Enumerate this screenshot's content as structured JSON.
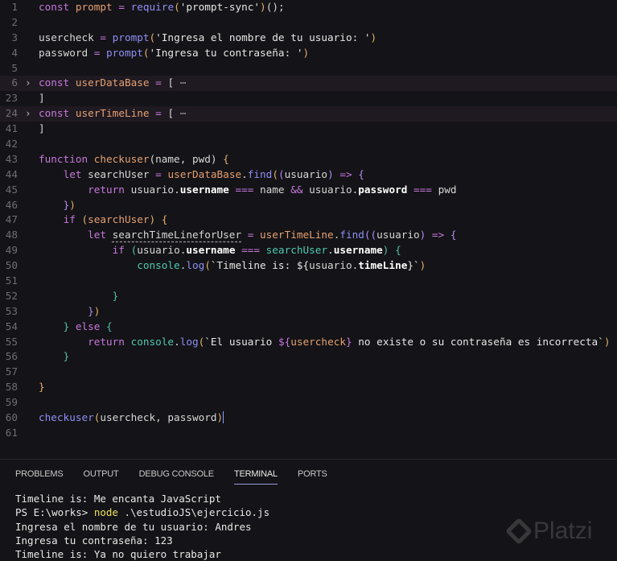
{
  "editor": {
    "lines": [
      {
        "n": "1",
        "t": [
          {
            "c": "kw",
            "s": "const "
          },
          {
            "c": "var",
            "s": "prompt"
          },
          {
            "c": "op",
            "s": " = "
          },
          {
            "c": "fn",
            "s": "require"
          },
          {
            "c": "gold",
            "s": "("
          },
          {
            "c": "str",
            "s": "'prompt-sync'"
          },
          {
            "c": "gold",
            "s": ")"
          },
          {
            "c": "",
            "s": "();"
          }
        ]
      },
      {
        "n": "2",
        "t": []
      },
      {
        "n": "3",
        "t": [
          {
            "c": "",
            "s": "usercheck "
          },
          {
            "c": "op",
            "s": "= "
          },
          {
            "c": "fn",
            "s": "prompt"
          },
          {
            "c": "gold",
            "s": "("
          },
          {
            "c": "str",
            "s": "'Ingresa el nombre de tu usuario: '"
          },
          {
            "c": "gold",
            "s": ")"
          }
        ]
      },
      {
        "n": "4",
        "t": [
          {
            "c": "",
            "s": "password "
          },
          {
            "c": "op",
            "s": "= "
          },
          {
            "c": "fn",
            "s": "prompt"
          },
          {
            "c": "gold",
            "s": "("
          },
          {
            "c": "str",
            "s": "'Ingresa tu contraseña: '"
          },
          {
            "c": "gold",
            "s": ")"
          }
        ]
      },
      {
        "n": "5",
        "t": []
      },
      {
        "n": "6",
        "fold": true,
        "hl": true,
        "t": [
          {
            "c": "kw",
            "s": "const "
          },
          {
            "c": "var",
            "s": "userDataBase"
          },
          {
            "c": "op",
            "s": " = "
          },
          {
            "c": "",
            "s": "[ "
          },
          {
            "c": "dim",
            "s": "⋯"
          }
        ]
      },
      {
        "n": "23",
        "t": [
          {
            "c": "",
            "s": "]"
          }
        ]
      },
      {
        "n": "24",
        "fold": true,
        "hl": true,
        "t": [
          {
            "c": "kw",
            "s": "const "
          },
          {
            "c": "var",
            "s": "userTimeLine"
          },
          {
            "c": "op",
            "s": " = "
          },
          {
            "c": "",
            "s": "[ "
          },
          {
            "c": "dim",
            "s": "⋯"
          }
        ]
      },
      {
        "n": "41",
        "t": [
          {
            "c": "",
            "s": "]"
          }
        ]
      },
      {
        "n": "42",
        "t": []
      },
      {
        "n": "43",
        "t": [
          {
            "c": "kw",
            "s": "function "
          },
          {
            "c": "var",
            "s": "checkuser"
          },
          {
            "c": "",
            "s": "(name, pwd) "
          },
          {
            "c": "gold",
            "s": "{"
          }
        ]
      },
      {
        "n": "44",
        "t": [
          {
            "c": "",
            "s": "    "
          },
          {
            "c": "kw",
            "s": "let "
          },
          {
            "c": "",
            "s": "searchUser "
          },
          {
            "c": "op",
            "s": "= "
          },
          {
            "c": "var",
            "s": "userDataBase"
          },
          {
            "c": "",
            "s": "."
          },
          {
            "c": "fn",
            "s": "find"
          },
          {
            "c": "gold",
            "s": "("
          },
          {
            "c": "pur",
            "s": "("
          },
          {
            "c": "",
            "s": "usuario"
          },
          {
            "c": "pur",
            "s": ")"
          },
          {
            "c": "op",
            "s": " => "
          },
          {
            "c": "pur",
            "s": "{"
          }
        ]
      },
      {
        "n": "45",
        "t": [
          {
            "c": "",
            "s": "        "
          },
          {
            "c": "kw",
            "s": "return "
          },
          {
            "c": "",
            "s": "usuario."
          },
          {
            "c": "prop",
            "s": "username"
          },
          {
            "c": "op",
            "s": " === "
          },
          {
            "c": "",
            "s": "name "
          },
          {
            "c": "op",
            "s": "&&"
          },
          {
            "c": "",
            "s": " usuario."
          },
          {
            "c": "prop",
            "s": "password"
          },
          {
            "c": "op",
            "s": " === "
          },
          {
            "c": "",
            "s": "pwd"
          }
        ]
      },
      {
        "n": "46",
        "t": [
          {
            "c": "",
            "s": "    "
          },
          {
            "c": "pur",
            "s": "}"
          },
          {
            "c": "gold",
            "s": ")"
          }
        ]
      },
      {
        "n": "47",
        "t": [
          {
            "c": "",
            "s": "    "
          },
          {
            "c": "kw",
            "s": "if "
          },
          {
            "c": "gold",
            "s": "("
          },
          {
            "c": "var",
            "s": "searchUser"
          },
          {
            "c": "gold",
            "s": ")"
          },
          {
            "c": "",
            "s": " "
          },
          {
            "c": "gold",
            "s": "{"
          }
        ]
      },
      {
        "n": "48",
        "t": [
          {
            "c": "",
            "s": "        "
          },
          {
            "c": "kw",
            "s": "let "
          },
          {
            "c": "sq",
            "s": "searchTimeLineforUser"
          },
          {
            "c": "op",
            "s": " = "
          },
          {
            "c": "var",
            "s": "userTimeLine"
          },
          {
            "c": "",
            "s": "."
          },
          {
            "c": "fn",
            "s": "find"
          },
          {
            "c": "pur",
            "s": "(("
          },
          {
            "c": "",
            "s": "usuario"
          },
          {
            "c": "pur",
            "s": ")"
          },
          {
            "c": "op",
            "s": " => "
          },
          {
            "c": "pur",
            "s": "{"
          }
        ]
      },
      {
        "n": "49",
        "t": [
          {
            "c": "",
            "s": "            "
          },
          {
            "c": "kw",
            "s": "if "
          },
          {
            "c": "grn",
            "s": "("
          },
          {
            "c": "",
            "s": "usuario."
          },
          {
            "c": "prop",
            "s": "username"
          },
          {
            "c": "op",
            "s": " === "
          },
          {
            "c": "teal",
            "s": "searchUser"
          },
          {
            "c": "",
            "s": "."
          },
          {
            "c": "prop",
            "s": "username"
          },
          {
            "c": "grn",
            "s": ")"
          },
          {
            "c": "",
            "s": " "
          },
          {
            "c": "grn",
            "s": "{"
          }
        ]
      },
      {
        "n": "50",
        "t": [
          {
            "c": "",
            "s": "                "
          },
          {
            "c": "teal",
            "s": "console"
          },
          {
            "c": "",
            "s": "."
          },
          {
            "c": "fn",
            "s": "log"
          },
          {
            "c": "gold",
            "s": "("
          },
          {
            "c": "str",
            "s": "`Timeline is: ${"
          },
          {
            "c": "",
            "s": "usuario."
          },
          {
            "c": "prop",
            "s": "timeLine"
          },
          {
            "c": "str",
            "s": "}`"
          },
          {
            "c": "gold",
            "s": ")"
          }
        ]
      },
      {
        "n": "51",
        "t": []
      },
      {
        "n": "52",
        "t": [
          {
            "c": "",
            "s": "            "
          },
          {
            "c": "grn",
            "s": "}"
          }
        ]
      },
      {
        "n": "53",
        "t": [
          {
            "c": "",
            "s": "        "
          },
          {
            "c": "pur",
            "s": "}"
          },
          {
            "c": "gold",
            "s": ")"
          }
        ]
      },
      {
        "n": "54",
        "t": [
          {
            "c": "",
            "s": "    "
          },
          {
            "c": "grn",
            "s": "} "
          },
          {
            "c": "kw",
            "s": "else "
          },
          {
            "c": "grn",
            "s": "{"
          }
        ]
      },
      {
        "n": "55",
        "t": [
          {
            "c": "",
            "s": "        "
          },
          {
            "c": "kw",
            "s": "return "
          },
          {
            "c": "teal",
            "s": "console"
          },
          {
            "c": "",
            "s": "."
          },
          {
            "c": "fn",
            "s": "log"
          },
          {
            "c": "gold",
            "s": "("
          },
          {
            "c": "str",
            "s": "`El usuario "
          },
          {
            "c": "kw",
            "s": "${"
          },
          {
            "c": "var",
            "s": "usercheck"
          },
          {
            "c": "kw",
            "s": "}"
          },
          {
            "c": "str",
            "s": " no existe o su contraseña es incorrecta`"
          },
          {
            "c": "gold",
            "s": ")"
          }
        ]
      },
      {
        "n": "56",
        "t": [
          {
            "c": "",
            "s": "    "
          },
          {
            "c": "grn",
            "s": "}"
          }
        ]
      },
      {
        "n": "57",
        "t": []
      },
      {
        "n": "58",
        "t": [
          {
            "c": "gold",
            "s": "}"
          }
        ]
      },
      {
        "n": "59",
        "t": []
      },
      {
        "n": "60",
        "t": [
          {
            "c": "fn",
            "s": "checkuser"
          },
          {
            "c": "gold",
            "s": "("
          },
          {
            "c": "",
            "s": "usercheck, password"
          },
          {
            "c": "gold caret",
            "s": ")"
          }
        ]
      },
      {
        "n": "61",
        "t": []
      }
    ]
  },
  "panel": {
    "tabs": [
      "PROBLEMS",
      "OUTPUT",
      "DEBUG CONSOLE",
      "TERMINAL",
      "PORTS"
    ],
    "active_tab": "TERMINAL"
  },
  "terminal": {
    "line1": "Timeline is: Me encanta JavaScript",
    "prompt": "PS E:\\works> ",
    "cmd": "node",
    "args": " .\\estudioJS\\ejercicio.js",
    "line3": "Ingresa el nombre de tu usuario: Andres",
    "line4": "Ingresa tu contraseña: 123",
    "line5": "Timeline is: Ya no quiero trabajar"
  },
  "watermark": "Platzi"
}
